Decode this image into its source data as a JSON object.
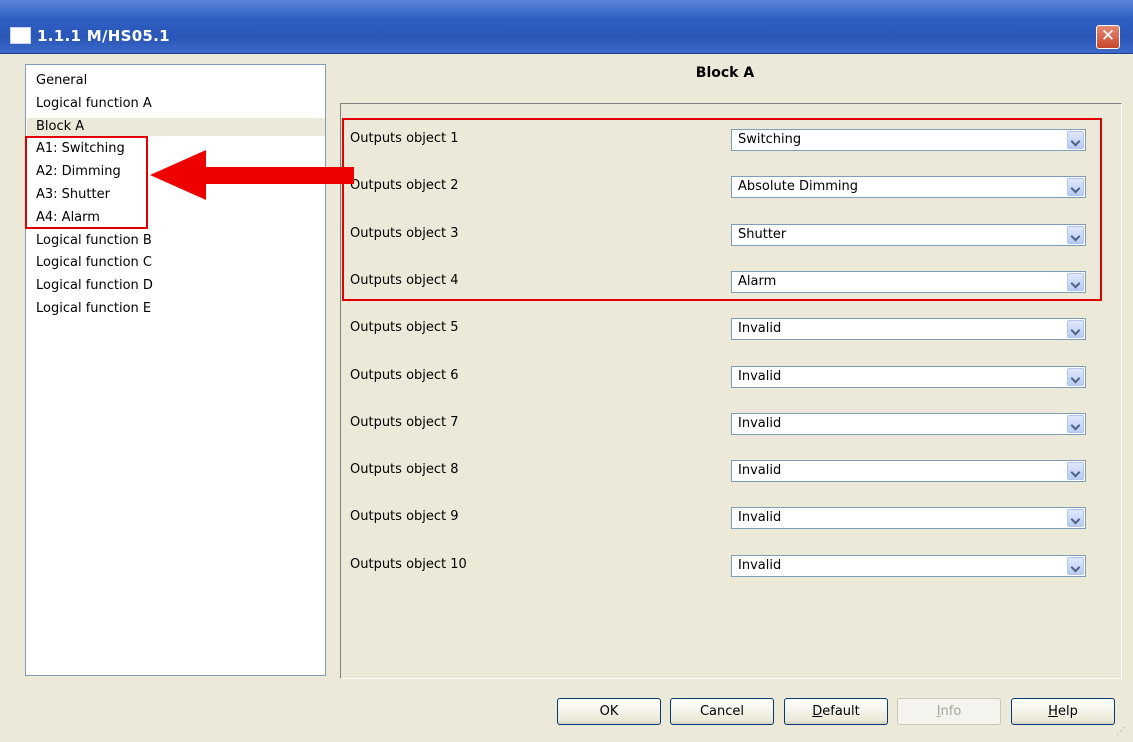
{
  "window": {
    "title": "1.1.1 M/HS05.1",
    "close_label": "✕"
  },
  "tree": {
    "items": [
      {
        "label": "General",
        "selected": false
      },
      {
        "label": "Logical function A",
        "selected": false
      },
      {
        "label": "Block A",
        "selected": true
      },
      {
        "label": "A1: Switching",
        "selected": false
      },
      {
        "label": "A2: Dimming",
        "selected": false
      },
      {
        "label": "A3: Shutter",
        "selected": false
      },
      {
        "label": "A4: Alarm",
        "selected": false
      },
      {
        "label": "Logical function B",
        "selected": false
      },
      {
        "label": "Logical function C",
        "selected": false
      },
      {
        "label": "Logical function D",
        "selected": false
      },
      {
        "label": "Logical function E",
        "selected": false
      }
    ]
  },
  "main": {
    "title": "Block A",
    "params": [
      {
        "label": "Outputs object 1",
        "value": "Switching"
      },
      {
        "label": "Outputs object 2",
        "value": "Absolute Dimming"
      },
      {
        "label": "Outputs object 3",
        "value": "Shutter"
      },
      {
        "label": "Outputs object 4",
        "value": "Alarm"
      },
      {
        "label": "Outputs object 5",
        "value": "Invalid"
      },
      {
        "label": "Outputs object 6",
        "value": "Invalid"
      },
      {
        "label": "Outputs object 7",
        "value": "Invalid"
      },
      {
        "label": "Outputs object 8",
        "value": "Invalid"
      },
      {
        "label": "Outputs object 9",
        "value": "Invalid"
      },
      {
        "label": "Outputs object 10",
        "value": "Invalid"
      }
    ]
  },
  "buttons": {
    "ok": "OK",
    "cancel": "Cancel",
    "default_rest": "efault",
    "default_key": "D",
    "info_key": "I",
    "info_rest": "nfo",
    "help_key": "H",
    "help_rest": "elp"
  },
  "colors": {
    "annotation": "#e00000",
    "titlebar": "#2f5fc4",
    "dialog_bg": "#ece9d8"
  },
  "icons": {
    "window": "window-icon",
    "close": "close-icon",
    "combo": "chevron-down-icon",
    "annotation": "red-arrow-left"
  }
}
